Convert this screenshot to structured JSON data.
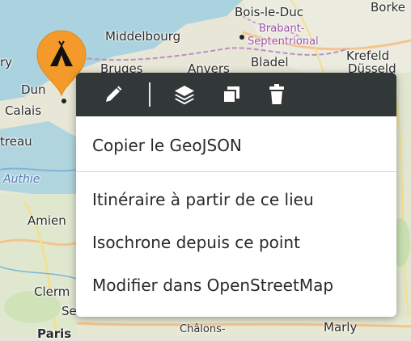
{
  "map": {
    "labels": {
      "bois_le_duc": "Bois-le-Duc",
      "borkel": "Borke",
      "middelbourg": "Middelbourg",
      "brabant_1": "Brabant-",
      "brabant_2": "Septentrional",
      "krefeld": "Krefeld",
      "dusseldorf": "Düsseld",
      "bruges": "Bruges",
      "anvers": "Anvers",
      "bladel": "Bladel",
      "ry": "ry",
      "dunkerque": "Dun",
      "calais": "Calais",
      "montreuil": "treau",
      "authie": "Authie",
      "amiens": "Amien",
      "clermont": "Clerm",
      "se": "Se",
      "paris": "Paris",
      "chalons": "Châlons-",
      "marly": "Marly"
    },
    "marker": {
      "icon": "tent-icon",
      "color": "#f39a2b"
    }
  },
  "popup": {
    "toolbar": {
      "edit_icon": "pencil-icon",
      "layers_icon": "layers-icon",
      "duplicate_icon": "copy-icon",
      "delete_icon": "trash-icon"
    },
    "items": [
      "Copier le GeoJSON",
      "Itinéraire à partir de ce lieu",
      "Isochrone depuis ce point",
      "Modifier dans OpenStreetMap"
    ]
  }
}
